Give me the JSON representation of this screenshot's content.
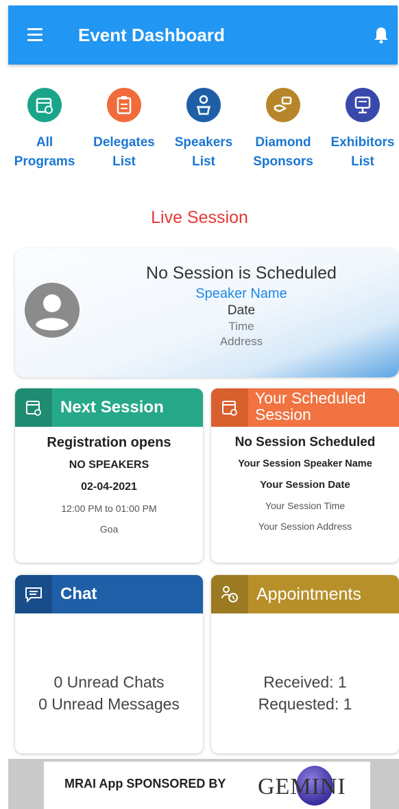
{
  "app_bar": {
    "title": "Event Dashboard"
  },
  "shortcuts": [
    {
      "label": "All\nPrograms",
      "icon": "calendar-icon",
      "color": "#1aa58a"
    },
    {
      "label": "Delegates\nList",
      "icon": "clipboard-icon",
      "color": "#f26b3a"
    },
    {
      "label": "Speakers\nList",
      "icon": "speaker-icon",
      "color": "#1f5fa8"
    },
    {
      "label": "Diamond\nSponsors",
      "icon": "handshake-icon",
      "color": "#b8862a"
    },
    {
      "label": "Exhibitors\nList",
      "icon": "monitor-icon",
      "color": "#3949ab"
    }
  ],
  "live_session": {
    "heading": "Live Session",
    "title": "No Session is Scheduled",
    "speaker": "Speaker Name",
    "date": "Date",
    "time": "Time",
    "address": "Address"
  },
  "next_session": {
    "header": "Next Session",
    "color": "#26a889",
    "line1": "Registration opens",
    "line2": "NO SPEAKERS",
    "line3": "02-04-2021",
    "line4": "12:00 PM to 01:00 PM",
    "line5": "Goa"
  },
  "scheduled_session": {
    "header": "Your Scheduled Session",
    "color": "#f07341",
    "line1": "No Session Scheduled",
    "line2": "Your Session Speaker Name",
    "line3": "Your Session Date",
    "line4": "Your Session Time",
    "line5": "Your Session Address"
  },
  "chat": {
    "header": "Chat",
    "color": "#1f5fa8",
    "unread_chats": "0 Unread Chats",
    "unread_messages": "0 Unread Messages"
  },
  "appointments": {
    "header": "Appointments",
    "color": "#b8902a",
    "received": "Received: 1",
    "requested": "Requested: 1"
  },
  "sponsor": {
    "text": "MRAI App SPONSORED BY",
    "logo_text": "GEMINI"
  }
}
